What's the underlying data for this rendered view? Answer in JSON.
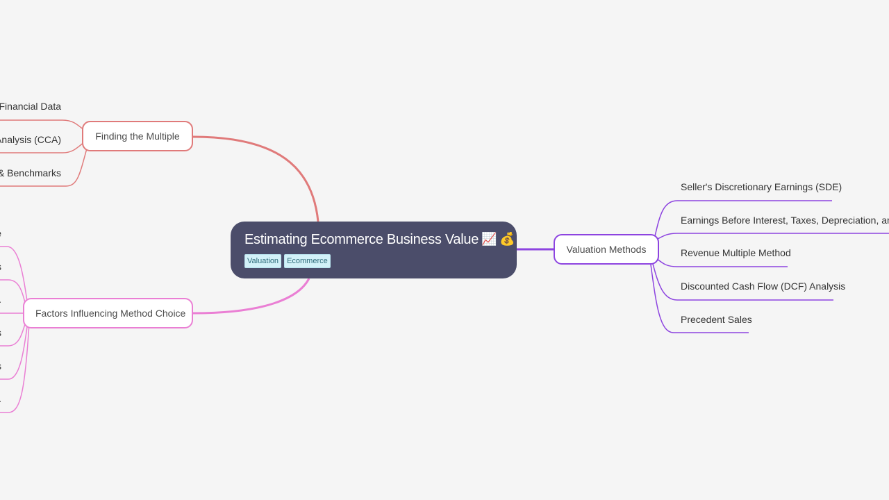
{
  "root": {
    "title": "Estimating Ecommerce Business Value",
    "emojis": [
      "📈",
      "💰"
    ],
    "tags": [
      "Valuation",
      "Ecommerce"
    ]
  },
  "branches": {
    "finding_multiple": {
      "label": "Finding the Multiple",
      "color": "#e07a7a",
      "children": [
        "Financial Data",
        "Analysis (CCA)",
        "& Benchmarks"
      ]
    },
    "factors": {
      "label": "Factors Influencing Method Choice",
      "color": "#ea7fd4",
      "children": [
        "e",
        "s",
        ".",
        "s",
        "s",
        "."
      ]
    },
    "methods": {
      "label": "Valuation Methods",
      "color": "#8d44e0",
      "children": [
        "Seller's Discretionary Earnings (SDE)",
        "Earnings Before Interest, Taxes, Depreciation, and ...",
        "Revenue Multiple Method",
        "Discounted Cash Flow (DCF) Analysis",
        "Precedent Sales"
      ]
    }
  }
}
